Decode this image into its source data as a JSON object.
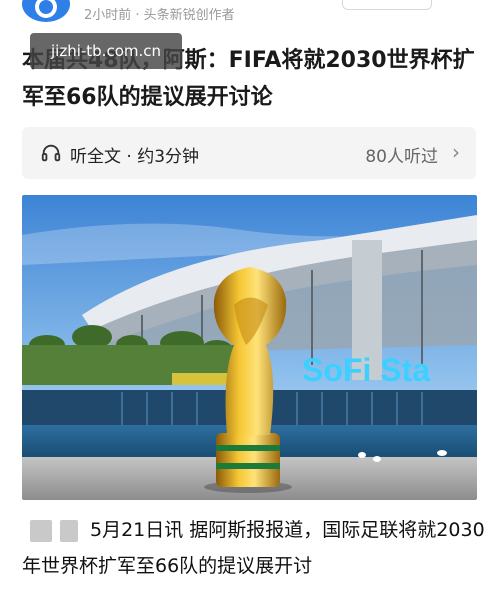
{
  "header": {
    "meta": "2小时前 · 头条新锐创作者"
  },
  "watermark": "jizhi-tb.com.cn",
  "article": {
    "title": "本届共48队，阿斯：FIFA将就2030世界杯扩军至66队的提议展开讨论",
    "listen_label": "听全文 · 约3分钟",
    "listen_count": "80人听过",
    "paragraph": "5月21日讯 据阿斯报报道，国际足联将就2030年世界杯扩军至66队的提议展开讨"
  },
  "photo": {
    "sign": "SoFi Sta"
  },
  "colors": {
    "accent": "#2f7fe8",
    "sign": "#3bd0ff"
  },
  "icons": [
    "avatar-logo-icon",
    "headphones-icon",
    "chevron-right-icon"
  ]
}
